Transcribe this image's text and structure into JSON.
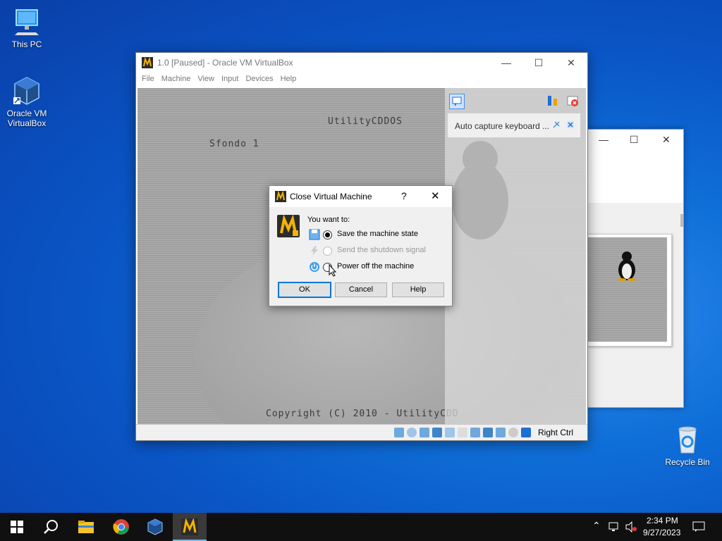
{
  "desktop": {
    "icons": [
      {
        "label": "This PC"
      },
      {
        "label": "Oracle VM VirtualBox"
      },
      {
        "label": "Recycle Bin"
      }
    ]
  },
  "vbox": {
    "title": "1.0 [Paused] - Oracle VM VirtualBox",
    "menu": [
      "File",
      "Machine",
      "View",
      "Input",
      "Devices",
      "Help"
    ],
    "screen_text": {
      "brand": "UtilityCDDOS",
      "item": "Sfondo 1",
      "copyright": "Copyright (C) 2010 - UtilityCDD"
    },
    "mini_toolbar": {
      "capture_text": "Auto capture keyboard ..."
    },
    "statusbar": {
      "host_key": "Right Ctrl"
    }
  },
  "dialog": {
    "title": "Close Virtual Machine",
    "help_glyph": "?",
    "prompt": "You want to:",
    "options": [
      {
        "label": "Save the machine state",
        "selected": true,
        "enabled": true
      },
      {
        "label": "Send the shutdown signal",
        "selected": false,
        "enabled": false
      },
      {
        "label": "Power off the machine",
        "selected": false,
        "enabled": true
      }
    ],
    "buttons": {
      "ok": "OK",
      "cancel": "Cancel",
      "help": "Help"
    }
  },
  "taskbar": {
    "clock_time": "2:34 PM",
    "clock_date": "9/27/2023"
  },
  "colors": {
    "accent": "#0078d7",
    "desktop": "#0a55c6",
    "taskbar": "#101010"
  }
}
